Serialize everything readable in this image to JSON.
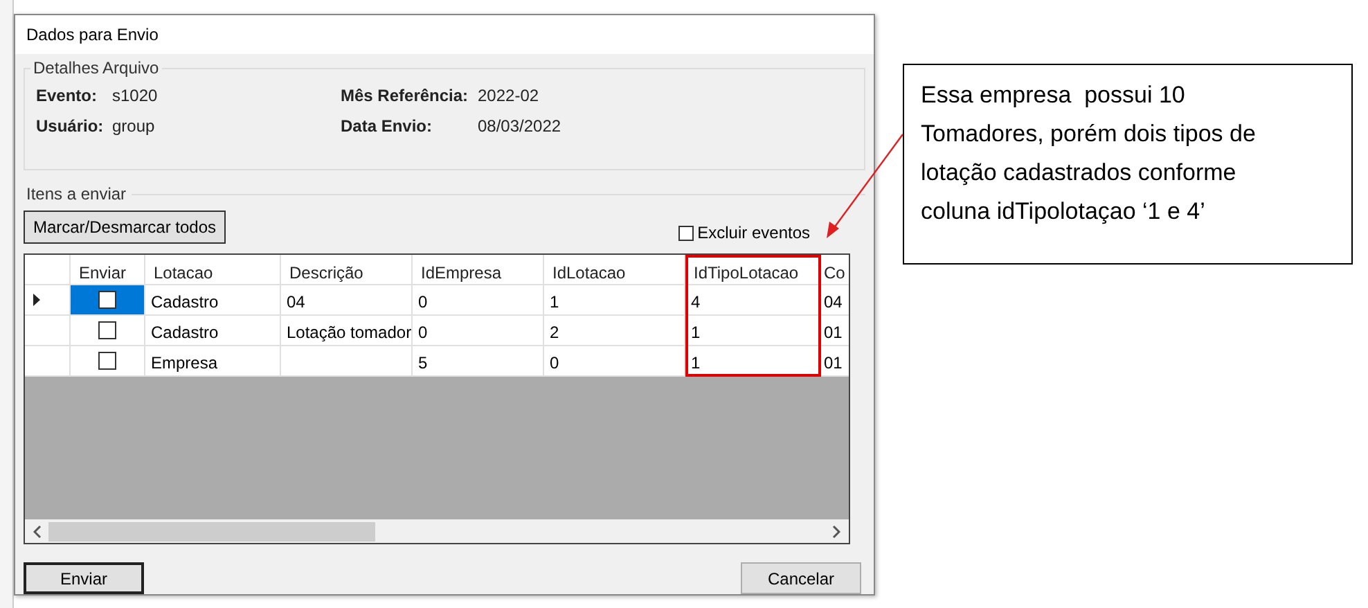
{
  "window": {
    "title": "Dados para Envio"
  },
  "details": {
    "title": "Detalhes Arquivo",
    "fields": [
      {
        "label": "Evento:",
        "value": "s1020"
      },
      {
        "label": "Mês Referência:",
        "value": "2022-02"
      },
      {
        "label": "Usuário:",
        "value": "group"
      },
      {
        "label": "Data Envio:",
        "value": "08/03/2022"
      }
    ]
  },
  "items": {
    "title": "Itens a enviar",
    "toggle_button": "Marcar/Desmarcar todos",
    "exclude_checkbox": {
      "label": "Excluir eventos",
      "checked": false
    }
  },
  "table": {
    "check_column": {
      "label": "Enviar"
    },
    "columns": [
      {
        "label": "Lotacao",
        "highlighted": false
      },
      {
        "label": "Descrição",
        "highlighted": false
      },
      {
        "label": "IdEmpresa",
        "highlighted": false
      },
      {
        "label": "IdLotacao",
        "highlighted": false
      },
      {
        "label": "IdTipoLotacao",
        "highlighted": true
      },
      {
        "label": "Co",
        "highlighted": false
      }
    ],
    "rows": [
      {
        "selected": true,
        "checked": false,
        "cells": [
          "Cadastro",
          "04",
          "0",
          "1",
          "4",
          "04"
        ]
      },
      {
        "selected": false,
        "checked": false,
        "cells": [
          "Cadastro",
          "Lotação tomador",
          "0",
          "2",
          "1",
          "01"
        ]
      },
      {
        "selected": false,
        "checked": false,
        "cells": [
          "Empresa",
          "",
          "5",
          "0",
          "1",
          "01"
        ]
      }
    ]
  },
  "buttons": [
    {
      "label": "Enviar",
      "kind": "default"
    },
    {
      "label": "Cancelar",
      "kind": "normal"
    }
  ],
  "callout": {
    "text": "Essa empresa  possui 10 Tomadores, porém dois tipos de lotação cadastrados conforme coluna idTipolotaçao ‘1 e 4’"
  }
}
